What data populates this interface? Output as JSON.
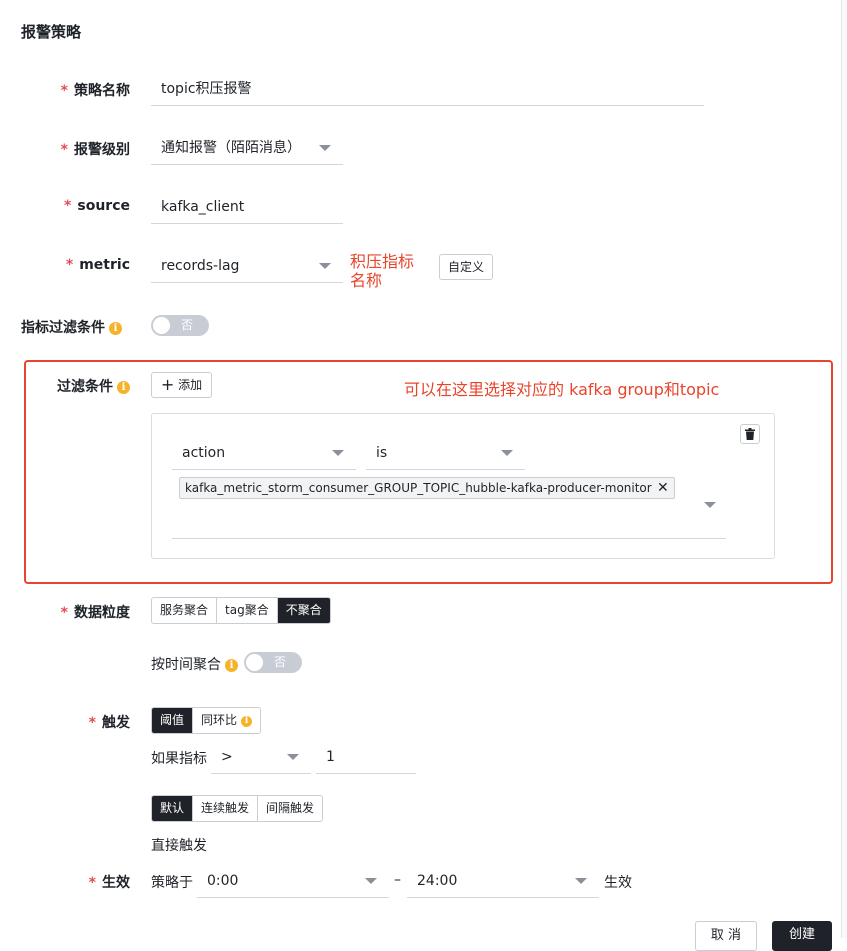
{
  "page": {
    "title": "报警策略"
  },
  "form": {
    "policy_name": {
      "label": "策略名称",
      "value": "topic积压报警"
    },
    "alarm_level": {
      "label": "报警级别",
      "value": "通知报警（陌陌消息）"
    },
    "source": {
      "label": "source",
      "value": "kafka_client"
    },
    "metric": {
      "label": "metric",
      "value": "records-lag",
      "custom_button": "自定义"
    },
    "metric_filter": {
      "label": "指标过滤条件",
      "toggle_label": "否"
    },
    "filter_conditions": {
      "label": "过滤条件",
      "add_button": "添加",
      "field": "action",
      "operator": "is",
      "tag": "kafka_metric_storm_consumer_GROUP_TOPIC_hubble-kafka-producer-monitor"
    },
    "granularity": {
      "label": "数据粒度",
      "options": [
        "服务聚合",
        "tag聚合",
        "不聚合"
      ],
      "selected": "不聚合",
      "time_agg_label": "按时间聚合",
      "time_agg_toggle": "否"
    },
    "trigger": {
      "label": "触发",
      "modes": [
        "阈值",
        "同环比"
      ],
      "selected_mode": "阈值",
      "if_label": "如果指标",
      "comparator": ">",
      "threshold": "1",
      "fire_modes": [
        "默认",
        "连续触发",
        "间隔触发"
      ],
      "selected_fire_mode": "默认",
      "fire_desc": "直接触发"
    },
    "effective": {
      "label": "生效",
      "prefix": "策略于",
      "start": "0:00",
      "separator": "–",
      "end": "24:00",
      "suffix": "生效"
    }
  },
  "annotations": {
    "metric_note_line1": "积压指标",
    "metric_note_line2": "名称",
    "filter_note": "可以在这里选择对应的 kafka group和topic"
  },
  "footer": {
    "cancel": "取 消",
    "create": "创建"
  },
  "colors": {
    "required": "#e34d59",
    "annotation": "#e8452c",
    "active": "#1f2329",
    "info": "#f5b32a"
  }
}
